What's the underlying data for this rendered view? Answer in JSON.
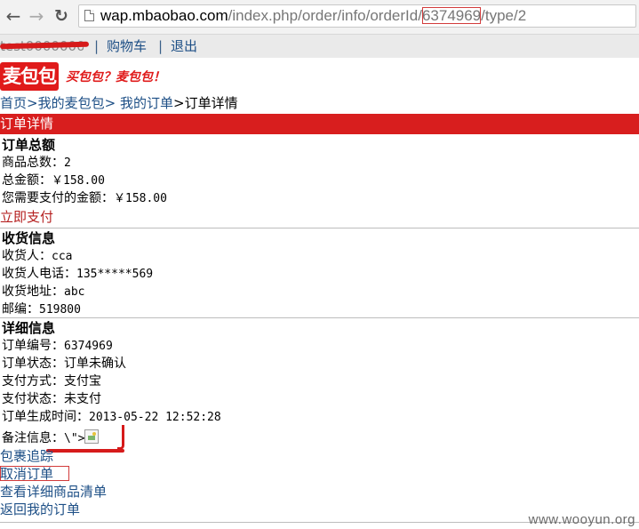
{
  "browser": {
    "url_host": "wap.mbaobao.com",
    "url_path_pre": "/index.php/order/info/orderId/",
    "url_order_id": "6374969",
    "url_path_post": "/type/2"
  },
  "header": {
    "username": "test0000000",
    "sep1": "|",
    "cart_link": "购物车",
    "sep2": "|",
    "logout_link": "退出",
    "logo_text": "麦包包",
    "slogan": "买包包？麦包包！"
  },
  "breadcrumb": {
    "home": "首页",
    "my": "我的麦包包",
    "orders": "我的订单",
    "sep": ">",
    "current": "订单详情"
  },
  "section_title": "订单详情",
  "totals": {
    "heading": "订单总额",
    "count_label": "商品总数：",
    "count_value": "2",
    "amount_label": "总金额：",
    "amount_value": "￥158.00",
    "payable_label": "您需要支付的金额：",
    "payable_value": "￥158.00",
    "pay_now": "立即支付"
  },
  "shipping": {
    "heading": "收货信息",
    "receiver_label": "收货人：",
    "receiver_value": "cca",
    "phone_label": "收货人电话：",
    "phone_value": "135*****569",
    "address_label": "收货地址：",
    "address_value": "abc",
    "zip_label": "邮编：",
    "zip_value": "519800"
  },
  "details": {
    "heading": "详细信息",
    "order_no_label": "订单编号：",
    "order_no_value": "6374969",
    "status_label": "订单状态：",
    "status_value": "订单未确认",
    "pay_method_label": "支付方式：",
    "pay_method_value": "支付宝",
    "pay_status_label": "支付状态：",
    "pay_status_value": "未支付",
    "created_label": "订单生成时间：",
    "created_value": "2013-05-22 12:52:28",
    "remark_label": "备注信息：",
    "remark_value": "\\\">"
  },
  "actions": {
    "track": "包裹追踪",
    "cancel": "取消订单",
    "view_items": "查看详细商品清单",
    "back": "返回我的订单"
  },
  "watermark": "www.wooyun.org",
  "colors": {
    "brand_red": "#d81e1e",
    "link_blue": "#1d4f86"
  }
}
